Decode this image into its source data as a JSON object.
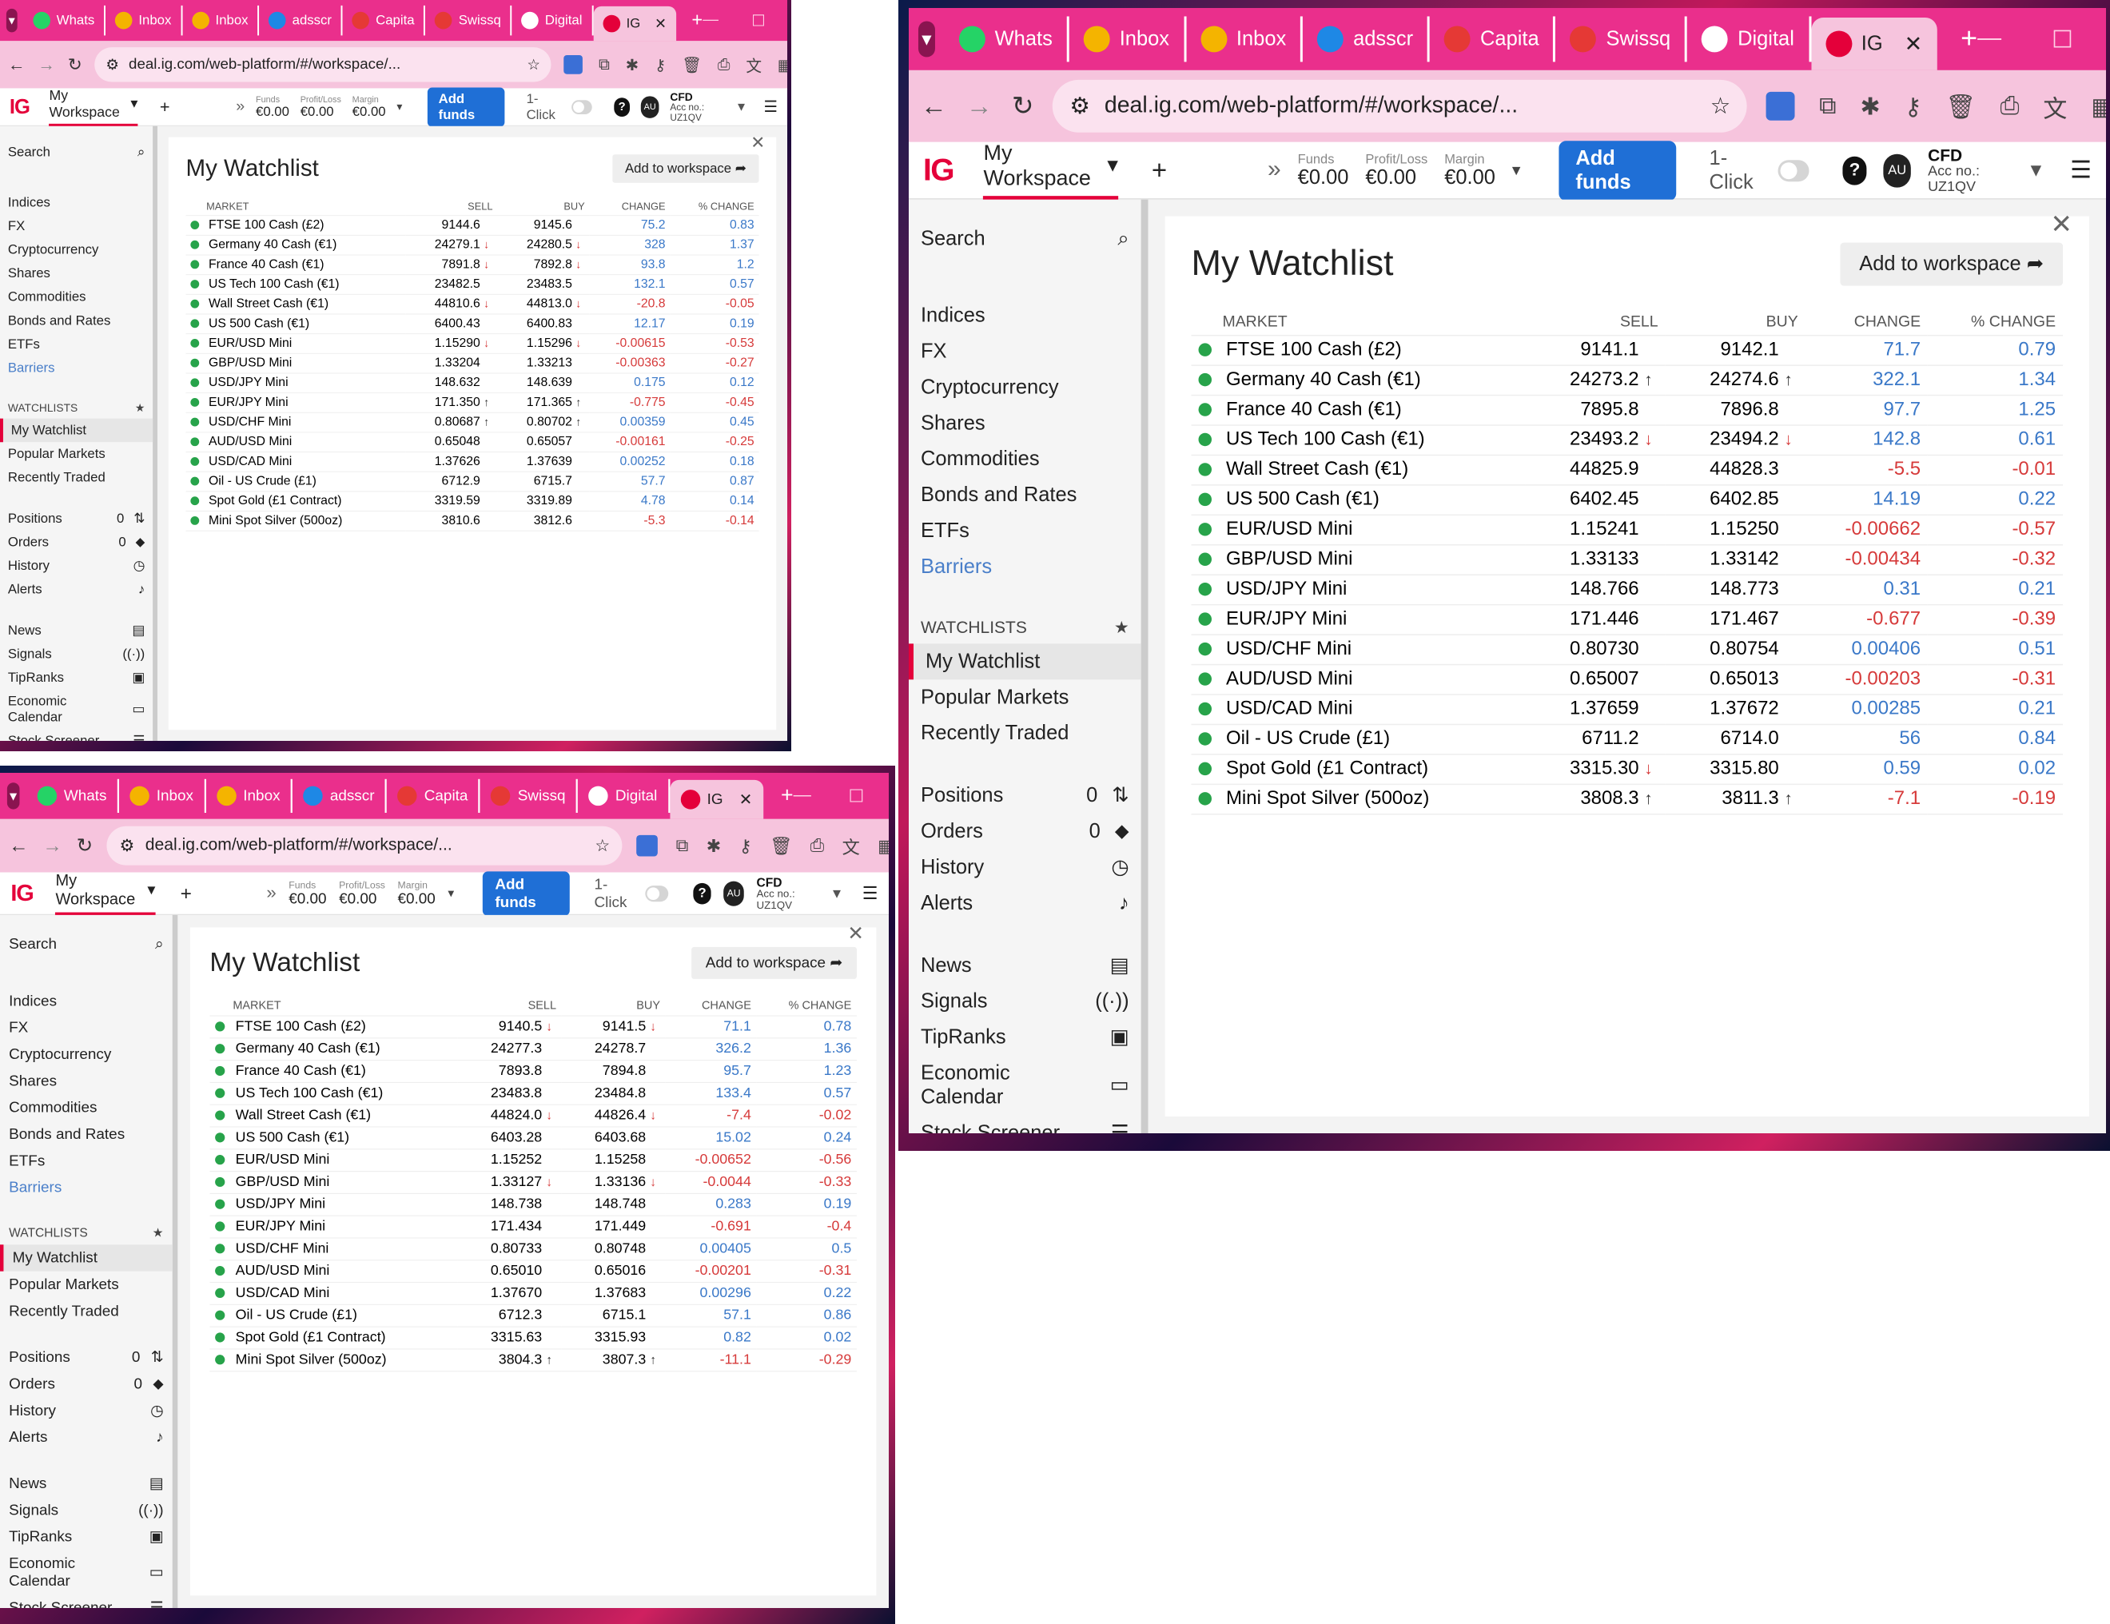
{
  "browser": {
    "tabs": [
      "Whats",
      "Inbox",
      "Inbox",
      "adsscr",
      "Capita",
      "Swissq",
      "Digital",
      "IG"
    ],
    "tab_colors": [
      "#25d366",
      "#f4b400",
      "#f4b400",
      "#1e88e5",
      "#e53935",
      "#e53935",
      "#ffffff",
      "#e4003a"
    ],
    "url": "deal.ig.com/web-platform/#/workspace/...",
    "win_min": "—",
    "win_max": "☐",
    "win_close": "✕"
  },
  "ig": {
    "logo": "IG",
    "workspace": "My Workspace",
    "plus": "+",
    "more": "»",
    "funds_label": "Funds",
    "funds_value": "€0.00",
    "pl_label": "Profit/Loss",
    "pl_value": "€0.00",
    "margin_label": "Margin",
    "margin_value": "€0.00",
    "add_funds": "Add funds",
    "one_click": "1-Click",
    "help": "?",
    "avatar": "AU",
    "account_type": "CFD",
    "account_no": "Acc no.: UZ1QV"
  },
  "sidebar": {
    "search": "Search",
    "markets": [
      "Indices",
      "FX",
      "Cryptocurrency",
      "Shares",
      "Commodities",
      "Bonds and Rates",
      "ETFs"
    ],
    "barriers": "Barriers",
    "watchlists_header": "WATCHLISTS",
    "watchlists": [
      "My Watchlist",
      "Popular Markets",
      "Recently Traded"
    ],
    "positions": "Positions",
    "positions_count": "0",
    "orders": "Orders",
    "orders_count": "0",
    "history": "History",
    "alerts": "Alerts",
    "news": "News",
    "signals": "Signals",
    "tipranks": "TipRanks",
    "economic_calendar": "Economic Calendar",
    "stock_screener": "Stock Screener"
  },
  "watchlist": {
    "title": "My Watchlist",
    "add_to_workspace": "Add to workspace",
    "close": "✕",
    "columns": [
      "MARKET",
      "SELL",
      "BUY",
      "CHANGE",
      "% CHANGE"
    ]
  },
  "snapshots": [
    {
      "rows": [
        [
          "FTSE 100 Cash (£2)",
          "9144.6",
          "",
          "9145.6",
          "",
          "75.2",
          "0.83"
        ],
        [
          "Germany 40 Cash (€1)",
          "24279.1",
          "down",
          "24280.5",
          "down",
          "328",
          "1.37"
        ],
        [
          "France 40 Cash (€1)",
          "7891.8",
          "down",
          "7892.8",
          "down",
          "93.8",
          "1.2"
        ],
        [
          "US Tech 100 Cash (€1)",
          "23482.5",
          "",
          "23483.5",
          "",
          "132.1",
          "0.57"
        ],
        [
          "Wall Street Cash (€1)",
          "44810.6",
          "down",
          "44813.0",
          "down",
          "-20.8",
          "-0.05"
        ],
        [
          "US 500 Cash (€1)",
          "6400.43",
          "",
          "6400.83",
          "",
          "12.17",
          "0.19"
        ],
        [
          "EUR/USD Mini",
          "1.15290",
          "down",
          "1.15296",
          "down",
          "-0.00615",
          "-0.53"
        ],
        [
          "GBP/USD Mini",
          "1.33204",
          "",
          "1.33213",
          "",
          "-0.00363",
          "-0.27"
        ],
        [
          "USD/JPY Mini",
          "148.632",
          "",
          "148.639",
          "",
          "0.175",
          "0.12"
        ],
        [
          "EUR/JPY Mini",
          "171.350",
          "up",
          "171.365",
          "up",
          "-0.775",
          "-0.45"
        ],
        [
          "USD/CHF Mini",
          "0.80687",
          "up",
          "0.80702",
          "up",
          "0.00359",
          "0.45"
        ],
        [
          "AUD/USD Mini",
          "0.65048",
          "",
          "0.65057",
          "",
          "-0.00161",
          "-0.25"
        ],
        [
          "USD/CAD Mini",
          "1.37626",
          "",
          "1.37639",
          "",
          "0.00252",
          "0.18"
        ],
        [
          "Oil - US Crude (£1)",
          "6712.9",
          "",
          "6715.7",
          "",
          "57.7",
          "0.87"
        ],
        [
          "Spot Gold (£1 Contract)",
          "3319.59",
          "",
          "3319.89",
          "",
          "4.78",
          "0.14"
        ],
        [
          "Mini Spot Silver (500oz)",
          "3810.6",
          "",
          "3812.6",
          "",
          "-5.3",
          "-0.14"
        ]
      ]
    },
    {
      "rows": [
        [
          "FTSE 100 Cash (£2)",
          "9141.1",
          "",
          "9142.1",
          "",
          "71.7",
          "0.79"
        ],
        [
          "Germany 40 Cash (€1)",
          "24273.2",
          "up",
          "24274.6",
          "up",
          "322.1",
          "1.34"
        ],
        [
          "France 40 Cash (€1)",
          "7895.8",
          "",
          "7896.8",
          "",
          "97.7",
          "1.25"
        ],
        [
          "US Tech 100 Cash (€1)",
          "23493.2",
          "down",
          "23494.2",
          "down",
          "142.8",
          "0.61"
        ],
        [
          "Wall Street Cash (€1)",
          "44825.9",
          "",
          "44828.3",
          "",
          "-5.5",
          "-0.01"
        ],
        [
          "US 500 Cash (€1)",
          "6402.45",
          "",
          "6402.85",
          "",
          "14.19",
          "0.22"
        ],
        [
          "EUR/USD Mini",
          "1.15241",
          "",
          "1.15250",
          "",
          "-0.00662",
          "-0.57"
        ],
        [
          "GBP/USD Mini",
          "1.33133",
          "",
          "1.33142",
          "",
          "-0.00434",
          "-0.32"
        ],
        [
          "USD/JPY Mini",
          "148.766",
          "",
          "148.773",
          "",
          "0.31",
          "0.21"
        ],
        [
          "EUR/JPY Mini",
          "171.446",
          "",
          "171.467",
          "",
          "-0.677",
          "-0.39"
        ],
        [
          "USD/CHF Mini",
          "0.80730",
          "",
          "0.80754",
          "",
          "0.00406",
          "0.51"
        ],
        [
          "AUD/USD Mini",
          "0.65007",
          "",
          "0.65013",
          "",
          "-0.00203",
          "-0.31"
        ],
        [
          "USD/CAD Mini",
          "1.37659",
          "",
          "1.37672",
          "",
          "0.00285",
          "0.21"
        ],
        [
          "Oil - US Crude (£1)",
          "6711.2",
          "",
          "6714.0",
          "",
          "56",
          "0.84"
        ],
        [
          "Spot Gold (£1 Contract)",
          "3315.30",
          "down",
          "3315.80",
          "",
          "0.59",
          "0.02"
        ],
        [
          "Mini Spot Silver (500oz)",
          "3808.3",
          "up",
          "3811.3",
          "up",
          "-7.1",
          "-0.19"
        ]
      ]
    },
    {
      "rows": [
        [
          "FTSE 100 Cash (£2)",
          "9140.5",
          "down",
          "9141.5",
          "down",
          "71.1",
          "0.78"
        ],
        [
          "Germany 40 Cash (€1)",
          "24277.3",
          "",
          "24278.7",
          "",
          "326.2",
          "1.36"
        ],
        [
          "France 40 Cash (€1)",
          "7893.8",
          "",
          "7894.8",
          "",
          "95.7",
          "1.23"
        ],
        [
          "US Tech 100 Cash (€1)",
          "23483.8",
          "",
          "23484.8",
          "",
          "133.4",
          "0.57"
        ],
        [
          "Wall Street Cash (€1)",
          "44824.0",
          "down",
          "44826.4",
          "down",
          "-7.4",
          "-0.02"
        ],
        [
          "US 500 Cash (€1)",
          "6403.28",
          "",
          "6403.68",
          "",
          "15.02",
          "0.24"
        ],
        [
          "EUR/USD Mini",
          "1.15252",
          "",
          "1.15258",
          "",
          "-0.00652",
          "-0.56"
        ],
        [
          "GBP/USD Mini",
          "1.33127",
          "down",
          "1.33136",
          "down",
          "-0.0044",
          "-0.33"
        ],
        [
          "USD/JPY Mini",
          "148.738",
          "",
          "148.748",
          "",
          "0.283",
          "0.19"
        ],
        [
          "EUR/JPY Mini",
          "171.434",
          "",
          "171.449",
          "",
          "-0.691",
          "-0.4"
        ],
        [
          "USD/CHF Mini",
          "0.80733",
          "",
          "0.80748",
          "",
          "0.00405",
          "0.5"
        ],
        [
          "AUD/USD Mini",
          "0.65010",
          "",
          "0.65016",
          "",
          "-0.00201",
          "-0.31"
        ],
        [
          "USD/CAD Mini",
          "1.37670",
          "",
          "1.37683",
          "",
          "0.00296",
          "0.22"
        ],
        [
          "Oil - US Crude (£1)",
          "6712.3",
          "",
          "6715.1",
          "",
          "57.1",
          "0.86"
        ],
        [
          "Spot Gold (£1 Contract)",
          "3315.63",
          "",
          "3315.93",
          "",
          "0.82",
          "0.02"
        ],
        [
          "Mini Spot Silver (500oz)",
          "3804.3",
          "up",
          "3807.3",
          "up",
          "-11.1",
          "-0.29"
        ]
      ]
    }
  ]
}
